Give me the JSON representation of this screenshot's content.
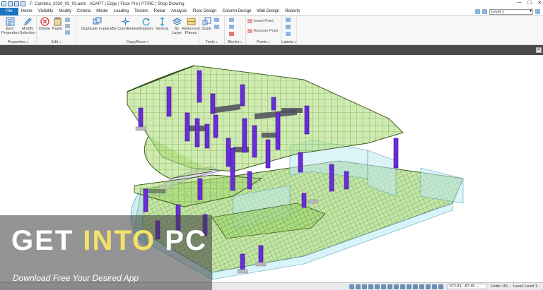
{
  "titlebar": {
    "title": "F: Cambria_2020_03_03.adm - ADAPT | Edge | Floor Pro | PT/RC | Shop Drawing",
    "minimize": "—",
    "maximize": "☐",
    "close": "✕"
  },
  "menu": {
    "tabs": [
      "File",
      "Home",
      "Visibility",
      "Modify",
      "Criteria",
      "Model",
      "Loading",
      "Tendon",
      "Rebar",
      "Analysis",
      "Floor Design",
      "Column Design",
      "Wall Design",
      "Reports"
    ],
    "level_value": "Level 1"
  },
  "ribbon": {
    "groups": {
      "properties": "Properties",
      "edit": "Edit",
      "copy_move": "Copy/Move",
      "tools": "Tools",
      "blocks": "Blocks",
      "points": "Points",
      "labels": "Labels"
    },
    "tools": {
      "item_properties": "Item Properties",
      "modify_selection": "Modify Selection",
      "delete": "Delete",
      "paste": "Paste",
      "duplicate_in_place": "Duplicate in-place",
      "by_coordinates": "By Coordinates",
      "rotation": "Rotation",
      "vertical": "Vertical",
      "by_layer": "By Layer",
      "reference_planes": "Reference Planes",
      "scale": "Scale",
      "insert_point": "Insert Point",
      "remove_point": "Remove Point"
    }
  },
  "toolstrip": {
    "close": "✕"
  },
  "statusbar": {
    "coords": "572.81, -87.45 ...",
    "units": "Units: US",
    "level": "Level: Level 1"
  },
  "watermark": {
    "get": "GET ",
    "into": "INTO",
    "pc": " PC",
    "tagline": "Download Free Your Desired App"
  },
  "colors": {
    "accent": "#1e73be",
    "slab_green": "#8fd14f",
    "wall_cyan": "#a8e3ef",
    "column_purple": "#6a2cd8",
    "beam_dark": "#3d5d1e"
  }
}
